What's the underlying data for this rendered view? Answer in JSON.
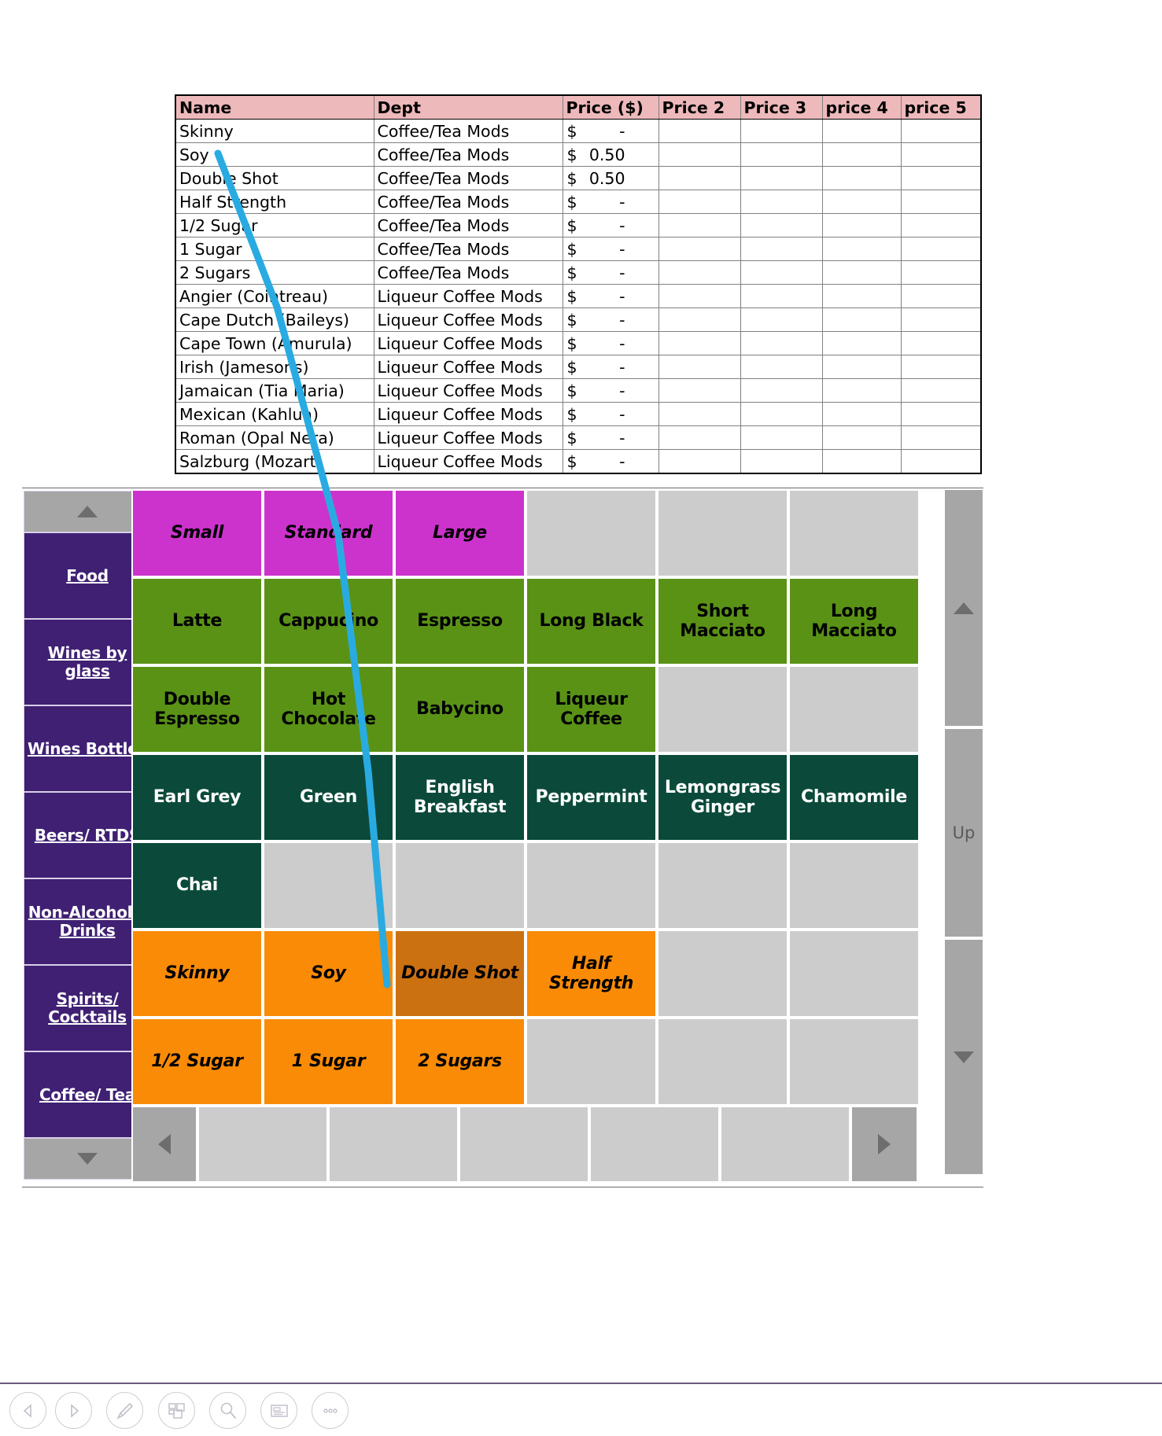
{
  "spreadsheet": {
    "headers": [
      "Name",
      "Dept",
      "Price ($)",
      "Price 2",
      "Price 3",
      "price 4",
      "price 5"
    ],
    "rows": [
      {
        "name": "Skinny",
        "dept": "Coffee/Tea Mods",
        "currency": "$",
        "price": "-",
        "price2": "",
        "price3": "",
        "price4": "",
        "price5": ""
      },
      {
        "name": "Soy",
        "dept": "Coffee/Tea Mods",
        "currency": "$",
        "price": "0.50",
        "price2": "",
        "price3": "",
        "price4": "",
        "price5": ""
      },
      {
        "name": "Double Shot",
        "dept": "Coffee/Tea Mods",
        "currency": "$",
        "price": "0.50",
        "price2": "",
        "price3": "",
        "price4": "",
        "price5": ""
      },
      {
        "name": "Half Strength",
        "dept": "Coffee/Tea Mods",
        "currency": "$",
        "price": "-",
        "price2": "",
        "price3": "",
        "price4": "",
        "price5": ""
      },
      {
        "name": "1/2 Sugar",
        "dept": "Coffee/Tea Mods",
        "currency": "$",
        "price": "-",
        "price2": "",
        "price3": "",
        "price4": "",
        "price5": ""
      },
      {
        "name": "1 Sugar",
        "dept": "Coffee/Tea Mods",
        "currency": "$",
        "price": "-",
        "price2": "",
        "price3": "",
        "price4": "",
        "price5": ""
      },
      {
        "name": "2 Sugars",
        "dept": "Coffee/Tea Mods",
        "currency": "$",
        "price": "-",
        "price2": "",
        "price3": "",
        "price4": "",
        "price5": ""
      },
      {
        "name": "Angier (Cointreau)",
        "dept": "Liqueur Coffee Mods",
        "currency": "$",
        "price": "-",
        "price2": "",
        "price3": "",
        "price4": "",
        "price5": ""
      },
      {
        "name": "Cape Dutch (Baileys)",
        "dept": "Liqueur Coffee Mods",
        "currency": "$",
        "price": "-",
        "price2": "",
        "price3": "",
        "price4": "",
        "price5": ""
      },
      {
        "name": "Cape Town (Amurula)",
        "dept": "Liqueur Coffee Mods",
        "currency": "$",
        "price": "-",
        "price2": "",
        "price3": "",
        "price4": "",
        "price5": ""
      },
      {
        "name": "Irish (Jamesons)",
        "dept": "Liqueur Coffee Mods",
        "currency": "$",
        "price": "-",
        "price2": "",
        "price3": "",
        "price4": "",
        "price5": ""
      },
      {
        "name": "Jamaican (Tia Maria)",
        "dept": "Liqueur Coffee Mods",
        "currency": "$",
        "price": "-",
        "price2": "",
        "price3": "",
        "price4": "",
        "price5": ""
      },
      {
        "name": "Mexican (Kahlua)",
        "dept": "Liqueur Coffee Mods",
        "currency": "$",
        "price": "-",
        "price2": "",
        "price3": "",
        "price4": "",
        "price5": ""
      },
      {
        "name": "Roman (Opal Nera)",
        "dept": "Liqueur Coffee Mods",
        "currency": "$",
        "price": "-",
        "price2": "",
        "price3": "",
        "price4": "",
        "price5": ""
      },
      {
        "name": "Salzburg (Mozart)",
        "dept": "Liqueur Coffee Mods",
        "currency": "$",
        "price": "-",
        "price2": "",
        "price3": "",
        "price4": "",
        "price5": ""
      }
    ]
  },
  "pos": {
    "categories": [
      {
        "label": "Food"
      },
      {
        "label": "Wines by glass"
      },
      {
        "label": "Wines Bottles"
      },
      {
        "label": "Beers/ RTDS"
      },
      {
        "label": "Non-Alcoholic Drinks"
      },
      {
        "label": "Spirits/ Cocktails"
      },
      {
        "label": "Coffee/ Tea"
      }
    ],
    "category_nav": {
      "up_icon": "triangle-up-icon",
      "down_icon": "triangle-down-icon"
    },
    "grid": [
      [
        {
          "label": "Small",
          "style": "size"
        },
        {
          "label": "Standard",
          "style": "size"
        },
        {
          "label": "Large",
          "style": "size"
        },
        {
          "label": "",
          "style": "empty"
        },
        {
          "label": "",
          "style": "empty"
        },
        {
          "label": "",
          "style": "empty"
        }
      ],
      [
        {
          "label": "Latte",
          "style": "coffee"
        },
        {
          "label": "Cappucino",
          "style": "coffee"
        },
        {
          "label": "Espresso",
          "style": "coffee"
        },
        {
          "label": "Long Black",
          "style": "coffee"
        },
        {
          "label": "Short Macciato",
          "style": "coffee"
        },
        {
          "label": "Long Macciato",
          "style": "coffee"
        }
      ],
      [
        {
          "label": "Double Espresso",
          "style": "coffee"
        },
        {
          "label": "Hot Chocolate",
          "style": "coffee"
        },
        {
          "label": "Babycino",
          "style": "coffee"
        },
        {
          "label": "Liqueur Coffee",
          "style": "coffee"
        },
        {
          "label": "",
          "style": "empty"
        },
        {
          "label": "",
          "style": "empty"
        }
      ],
      [
        {
          "label": "Earl Grey",
          "style": "tea"
        },
        {
          "label": "Green",
          "style": "tea"
        },
        {
          "label": "English Breakfast",
          "style": "tea"
        },
        {
          "label": "Peppermint",
          "style": "tea"
        },
        {
          "label": "Lemongrass Ginger",
          "style": "tea"
        },
        {
          "label": "Chamomile",
          "style": "tea"
        }
      ],
      [
        {
          "label": "Chai",
          "style": "tea"
        },
        {
          "label": "",
          "style": "empty"
        },
        {
          "label": "",
          "style": "empty"
        },
        {
          "label": "",
          "style": "empty"
        },
        {
          "label": "",
          "style": "empty"
        },
        {
          "label": "",
          "style": "empty"
        }
      ],
      [
        {
          "label": "Skinny",
          "style": "mod"
        },
        {
          "label": "Soy",
          "style": "mod"
        },
        {
          "label": "Double Shot",
          "style": "mod-sel"
        },
        {
          "label": "Half Strength",
          "style": "mod"
        },
        {
          "label": "",
          "style": "empty"
        },
        {
          "label": "",
          "style": "empty"
        }
      ],
      [
        {
          "label": "1/2 Sugar",
          "style": "mod"
        },
        {
          "label": "1 Sugar",
          "style": "mod"
        },
        {
          "label": "2 Sugars",
          "style": "mod"
        },
        {
          "label": "",
          "style": "empty"
        },
        {
          "label": "",
          "style": "empty"
        },
        {
          "label": "",
          "style": "empty"
        }
      ]
    ],
    "pager": {
      "prev_icon": "triangle-left-icon",
      "next_icon": "triangle-right-icon",
      "slots": [
        "",
        "",
        "",
        "",
        ""
      ]
    },
    "scrollbar": {
      "up_arrow_icon": "triangle-up-icon",
      "up_label": "Up",
      "down_arrow_icon": "triangle-down-icon"
    }
  },
  "toolbar": {
    "items": [
      {
        "icon": "back-arrow-icon"
      },
      {
        "icon": "forward-arrow-icon"
      },
      {
        "icon": "pen-icon"
      },
      {
        "icon": "pages-icon"
      },
      {
        "icon": "search-icon"
      },
      {
        "icon": "note-icon"
      },
      {
        "icon": "more-options-icon"
      }
    ]
  },
  "annotation": {
    "color": "#29abe2",
    "shape": "ink-line"
  },
  "colors": {
    "header_pink": "#eeb9bb",
    "category_purple": "#3f2073",
    "size_magenta": "#cc33cc",
    "coffee_green": "#5a9216",
    "tea_dark_green": "#0b4a3a",
    "mod_orange": "#f98b07",
    "mod_selected_orange": "#cc7111",
    "empty_grey": "#cccccc",
    "nav_grey": "#a6a6a6"
  }
}
